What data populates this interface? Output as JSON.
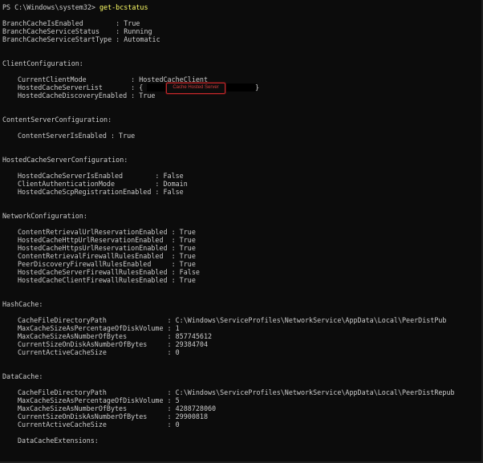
{
  "prompt": "PS C:\\Windows\\system32> ",
  "command": "get-bcstatus",
  "top": [
    "BranchCacheIsEnabled        : True",
    "BranchCacheServiceStatus    : Running",
    "BranchCacheServiceStartType : Automatic"
  ],
  "client_configuration": {
    "header": "ClientConfiguration:",
    "line1": "CurrentClientMode           : HostedCacheClient",
    "line2_prefix": "HostedCacheServerList       : {",
    "line2_suffix": "}",
    "annotation": "Cache Hosted Server",
    "line3": "HostedCacheDiscoveryEnabled : True"
  },
  "content_server_configuration": {
    "header": "ContentServerConfiguration:",
    "lines": [
      "ContentServerIsEnabled : True"
    ]
  },
  "hosted_cache_server_configuration": {
    "header": "HostedCacheServerConfiguration:",
    "lines": [
      "HostedCacheServerIsEnabled        : False",
      "ClientAuthenticationMode          : Domain",
      "HostedCacheScpRegistrationEnabled : False"
    ]
  },
  "network_configuration": {
    "header": "NetworkConfiguration:",
    "lines": [
      "ContentRetrievalUrlReservationEnabled : True",
      "HostedCacheHttpUrlReservationEnabled  : True",
      "HostedCacheHttpsUrlReservationEnabled : True",
      "ContentRetrievalFirewallRulesEnabled  : True",
      "PeerDiscoveryFirewallRulesEnabled     : True",
      "HostedCacheServerFirewallRulesEnabled : False",
      "HostedCacheClientFirewallRulesEnabled : True"
    ]
  },
  "hash_cache": {
    "header": "HashCache:",
    "lines": [
      "CacheFileDirectoryPath               : C:\\Windows\\ServiceProfiles\\NetworkService\\AppData\\Local\\PeerDistPub",
      "MaxCacheSizeAsPercentageOfDiskVolume : 1",
      "MaxCacheSizeAsNumberOfBytes          : 857745612",
      "CurrentSizeOnDiskAsNumberOfBytes     : 29384704",
      "CurrentActiveCacheSize               : 0"
    ]
  },
  "data_cache": {
    "header": "DataCache:",
    "lines": [
      "CacheFileDirectoryPath               : C:\\Windows\\ServiceProfiles\\NetworkService\\AppData\\Local\\PeerDistRepub",
      "MaxCacheSizeAsPercentageOfDiskVolume : 5",
      "MaxCacheSizeAsNumberOfBytes          : 4288728060",
      "CurrentSizeOnDiskAsNumberOfBytes     : 29900818",
      "CurrentActiveCacheSize               : 0"
    ],
    "extensions": "DataCacheExtensions:"
  },
  "colors": {
    "background": "#0c0c0c",
    "text": "#cccccc",
    "command": "#ffff66",
    "annotation_border": "#c0282c"
  }
}
